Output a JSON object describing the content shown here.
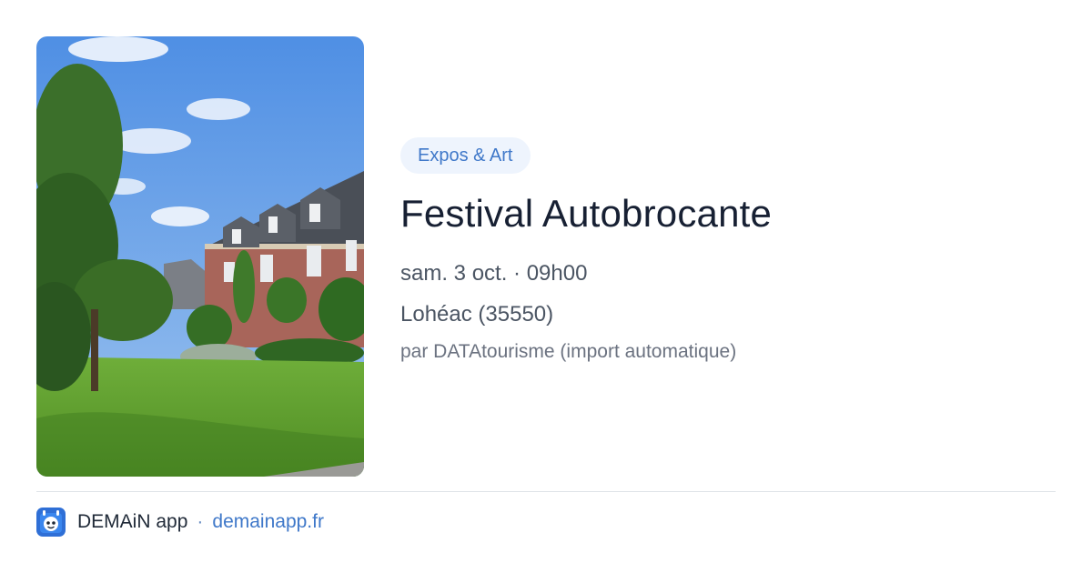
{
  "event": {
    "category": "Expos & Art",
    "title": "Festival Autobrocante",
    "date": "sam. 3 oct. · 09h00",
    "location": "Lohéac (35550)",
    "author": "par DATAtourisme (import automatique)",
    "image_icon": "event-photo-manor-house"
  },
  "footer": {
    "app_name": "DEMAiN app",
    "separator": "·",
    "domain": "demainapp.fr",
    "app_icon": "demain-app-icon"
  },
  "colors": {
    "accent": "#3f78c9",
    "badge_bg": "#eef4fd",
    "title": "#172033",
    "secondary_text": "#4b5563",
    "muted_text": "#6b7280"
  }
}
